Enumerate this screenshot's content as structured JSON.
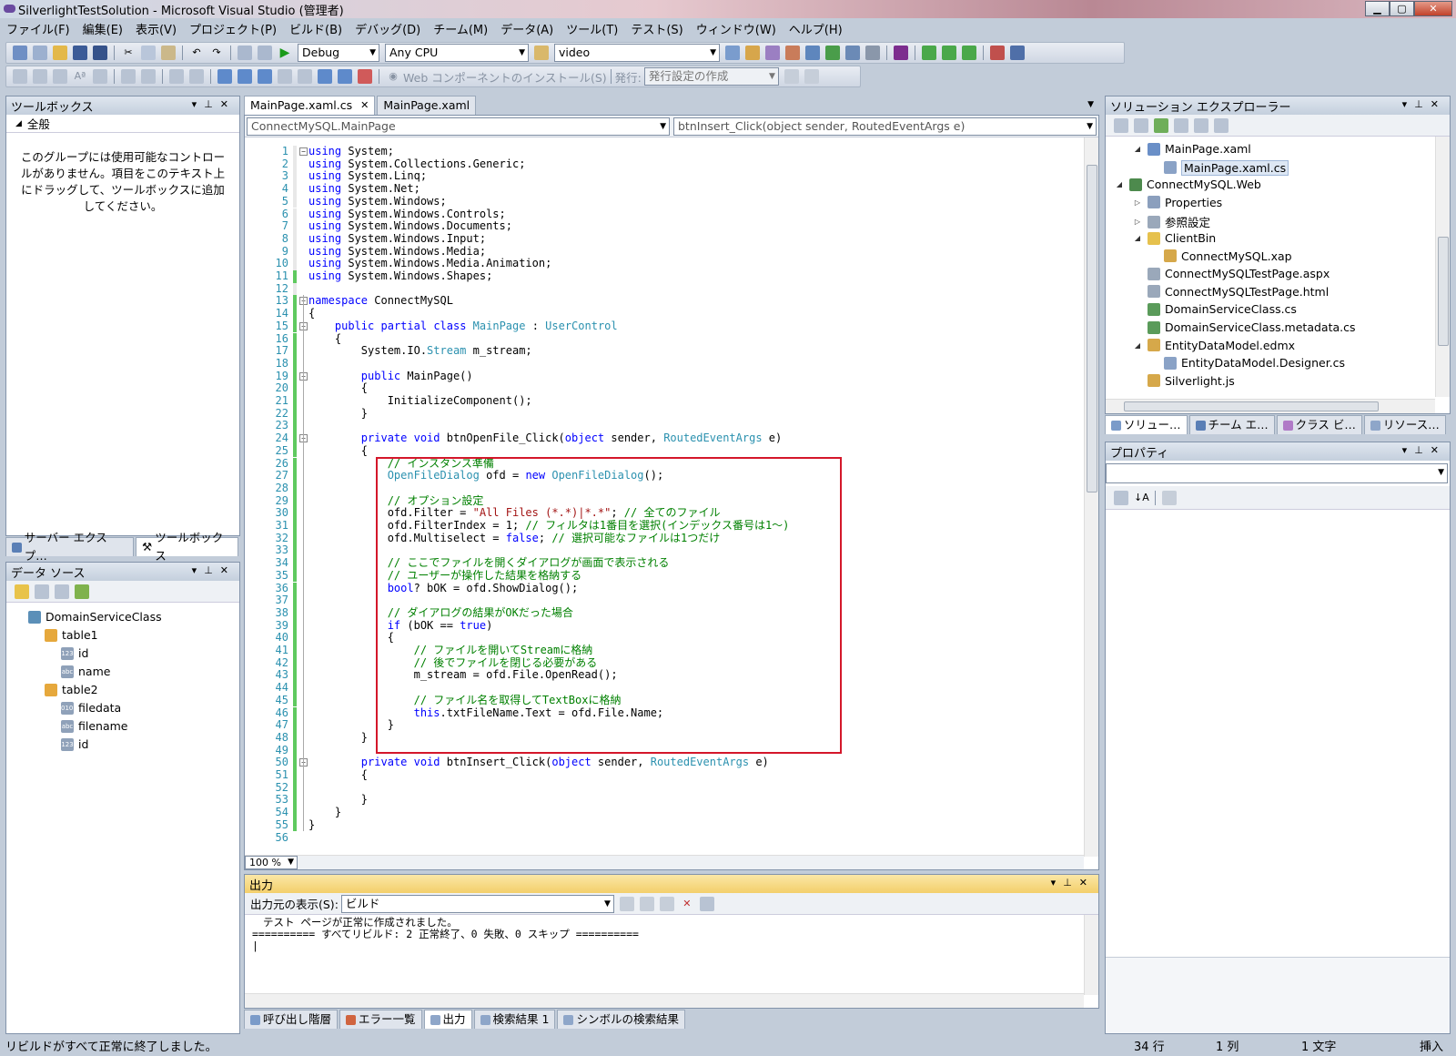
{
  "window": {
    "title": "SilverlightTestSolution - Microsoft Visual Studio (管理者)",
    "min": "▁",
    "max": "▢",
    "close": "✕"
  },
  "menu": [
    "ファイル(F)",
    "編集(E)",
    "表示(V)",
    "プロジェクト(P)",
    "ビルド(B)",
    "デバッグ(D)",
    "チーム(M)",
    "データ(A)",
    "ツール(T)",
    "テスト(S)",
    "ウィンドウ(W)",
    "ヘルプ(H)"
  ],
  "toolbar": {
    "config": "Debug",
    "platform": "Any CPU",
    "find": "video",
    "web_install": "Web コンポーネントのインストール(S)",
    "publish_label": "発行:",
    "publish_combo": "発行設定の作成"
  },
  "toolbox": {
    "title": "ツールボックス",
    "group": "全般",
    "message": "このグループには使用可能なコントロールがありません。項目をこのテキスト上にドラッグして、ツールボックスに追加してください。",
    "tabs": [
      "サーバー エクスプ…",
      "ツールボックス"
    ]
  },
  "datasource": {
    "title": "データ ソース",
    "root": "DomainServiceClass",
    "items": [
      {
        "label": "table1"
      },
      {
        "label": "id"
      },
      {
        "label": "name"
      },
      {
        "label": "table2"
      },
      {
        "label": "filedata"
      },
      {
        "label": "filename"
      },
      {
        "label": "id"
      }
    ]
  },
  "editor": {
    "tabs": [
      "MainPage.xaml.cs",
      "MainPage.xaml"
    ],
    "class_combo": "ConnectMySQL.MainPage",
    "member_combo": "btnInsert_Click(object sender, RoutedEventArgs e)",
    "zoom": "100 %",
    "lines": [
      "using System;",
      "using System.Collections.Generic;",
      "using System.Linq;",
      "using System.Net;",
      "using System.Windows;",
      "using System.Windows.Controls;",
      "using System.Windows.Documents;",
      "using System.Windows.Input;",
      "using System.Windows.Media;",
      "using System.Windows.Media.Animation;",
      "using System.Windows.Shapes;",
      "",
      "namespace ConnectMySQL",
      "{",
      "    public partial class MainPage : UserControl",
      "    {",
      "        System.IO.Stream m_stream;",
      "",
      "        public MainPage()",
      "        {",
      "            InitializeComponent();",
      "        }",
      "",
      "        private void btnOpenFile_Click(object sender, RoutedEventArgs e)",
      "        {",
      "            // インスタンス準備",
      "            OpenFileDialog ofd = new OpenFileDialog();",
      "",
      "            // オプション設定",
      "            ofd.Filter = \"All Files (*.*)|*.*\"; // 全てのファイル",
      "            ofd.FilterIndex = 1; // フィルタは1番目を選択(インデックス番号は1～)",
      "            ofd.Multiselect = false; // 選択可能なファイルは1つだけ",
      "",
      "            // ここでファイルを開くダイアログが画面で表示される",
      "            // ユーザーが操作した結果を格納する",
      "            bool? bOK = ofd.ShowDialog();",
      "",
      "            // ダイアログの結果がOKだった場合",
      "            if (bOK == true)",
      "            {",
      "                // ファイルを開いてStreamに格納",
      "                // 後でファイルを閉じる必要がある",
      "                m_stream = ofd.File.OpenRead();",
      "",
      "                // ファイル名を取得してTextBoxに格納",
      "                this.txtFileName.Text = ofd.File.Name;",
      "            }",
      "        }",
      "",
      "        private void btnInsert_Click(object sender, RoutedEventArgs e)",
      "        {",
      "",
      "        }",
      "    }",
      "}",
      ""
    ]
  },
  "output": {
    "title": "出力",
    "source_label": "出力元の表示(S):",
    "source_value": "ビルド",
    "lines": [
      "テスト ページが正常に作成されました。",
      "========== すべてリビルド: 2 正常終了、0 失敗、0 スキップ =========="
    ]
  },
  "bottom_tabs": [
    "呼び出し階層",
    "エラー一覧",
    "出力",
    "検索結果 1",
    "シンボルの検索結果"
  ],
  "solution": {
    "title": "ソリューション エクスプローラー",
    "items": [
      "MainPage.xaml",
      "MainPage.xaml.cs",
      "ConnectMySQL.Web",
      "Properties",
      "参照設定",
      "ClientBin",
      "ConnectMySQL.xap",
      "ConnectMySQLTestPage.aspx",
      "ConnectMySQLTestPage.html",
      "DomainServiceClass.cs",
      "DomainServiceClass.metadata.cs",
      "EntityDataModel.edmx",
      "EntityDataModel.Designer.cs",
      "Silverlight.js"
    ],
    "tabs": [
      "ソリュー…",
      "チーム エ…",
      "クラス ビ…",
      "リソース…"
    ]
  },
  "properties": {
    "title": "プロパティ"
  },
  "status": {
    "message": "リビルドがすべて正常に終了しました。",
    "line": "34 行",
    "col": "1 列",
    "ch": "1 文字",
    "mode": "挿入"
  },
  "colors": {
    "keyword": "#0000ff",
    "type": "#2b91af",
    "comment": "#008000",
    "string": "#a31515",
    "highlight_box": "#d4172a"
  }
}
